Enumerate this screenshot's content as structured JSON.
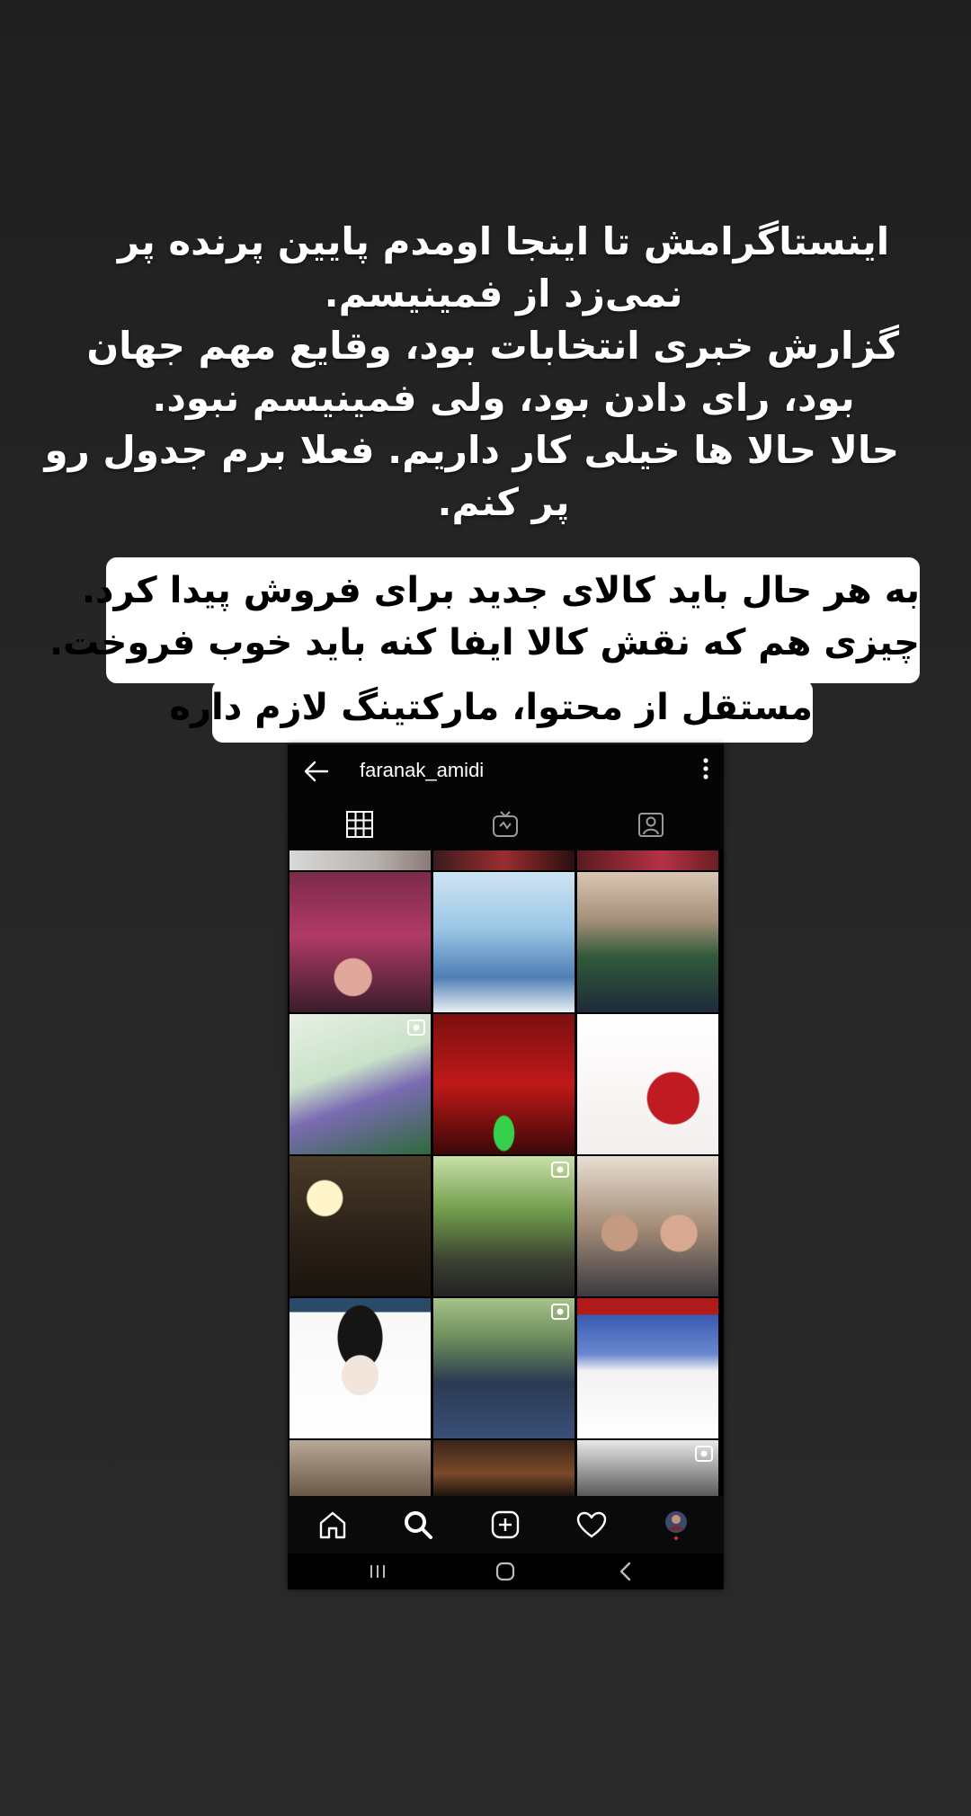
{
  "caption": {
    "lines": [
      "اینستاگرامش تا اینجا اومدم پایین پرنده پر",
      "نمی‌زد از فمینیسم.",
      "گزارش خبری انتخابات بود، وقایع مهم جهان",
      "بود، رای دادن بود، ولی فمینیسم نبود.",
      "حالا حالا ها خیلی کار داریم. فعلا برم جدول رو",
      "پر کنم."
    ]
  },
  "highlight": {
    "lines": [
      "به هر حال باید کالای جدید برای فروش پیدا کرد.",
      "چیزی هم که نقش کالا ایفا کنه باید خوب فروخت.",
      "مستقل از محتوا، مارکتینگ لازم داره"
    ]
  },
  "profile": {
    "username": "faranak_amidi"
  },
  "tabs": [
    "grid-icon",
    "igtv-icon",
    "tagged-icon"
  ],
  "bottom_nav": [
    "home-icon",
    "search-icon",
    "add-post-icon",
    "heart-icon",
    "profile-avatar"
  ],
  "android_nav": [
    "recents-icon",
    "home-button-icon",
    "back-icon"
  ],
  "colors": {
    "background": "#242424",
    "caption_text": "#ffffff",
    "highlight_bg": "#ffffff",
    "highlight_text": "#000000",
    "app_bg": "#000000"
  }
}
